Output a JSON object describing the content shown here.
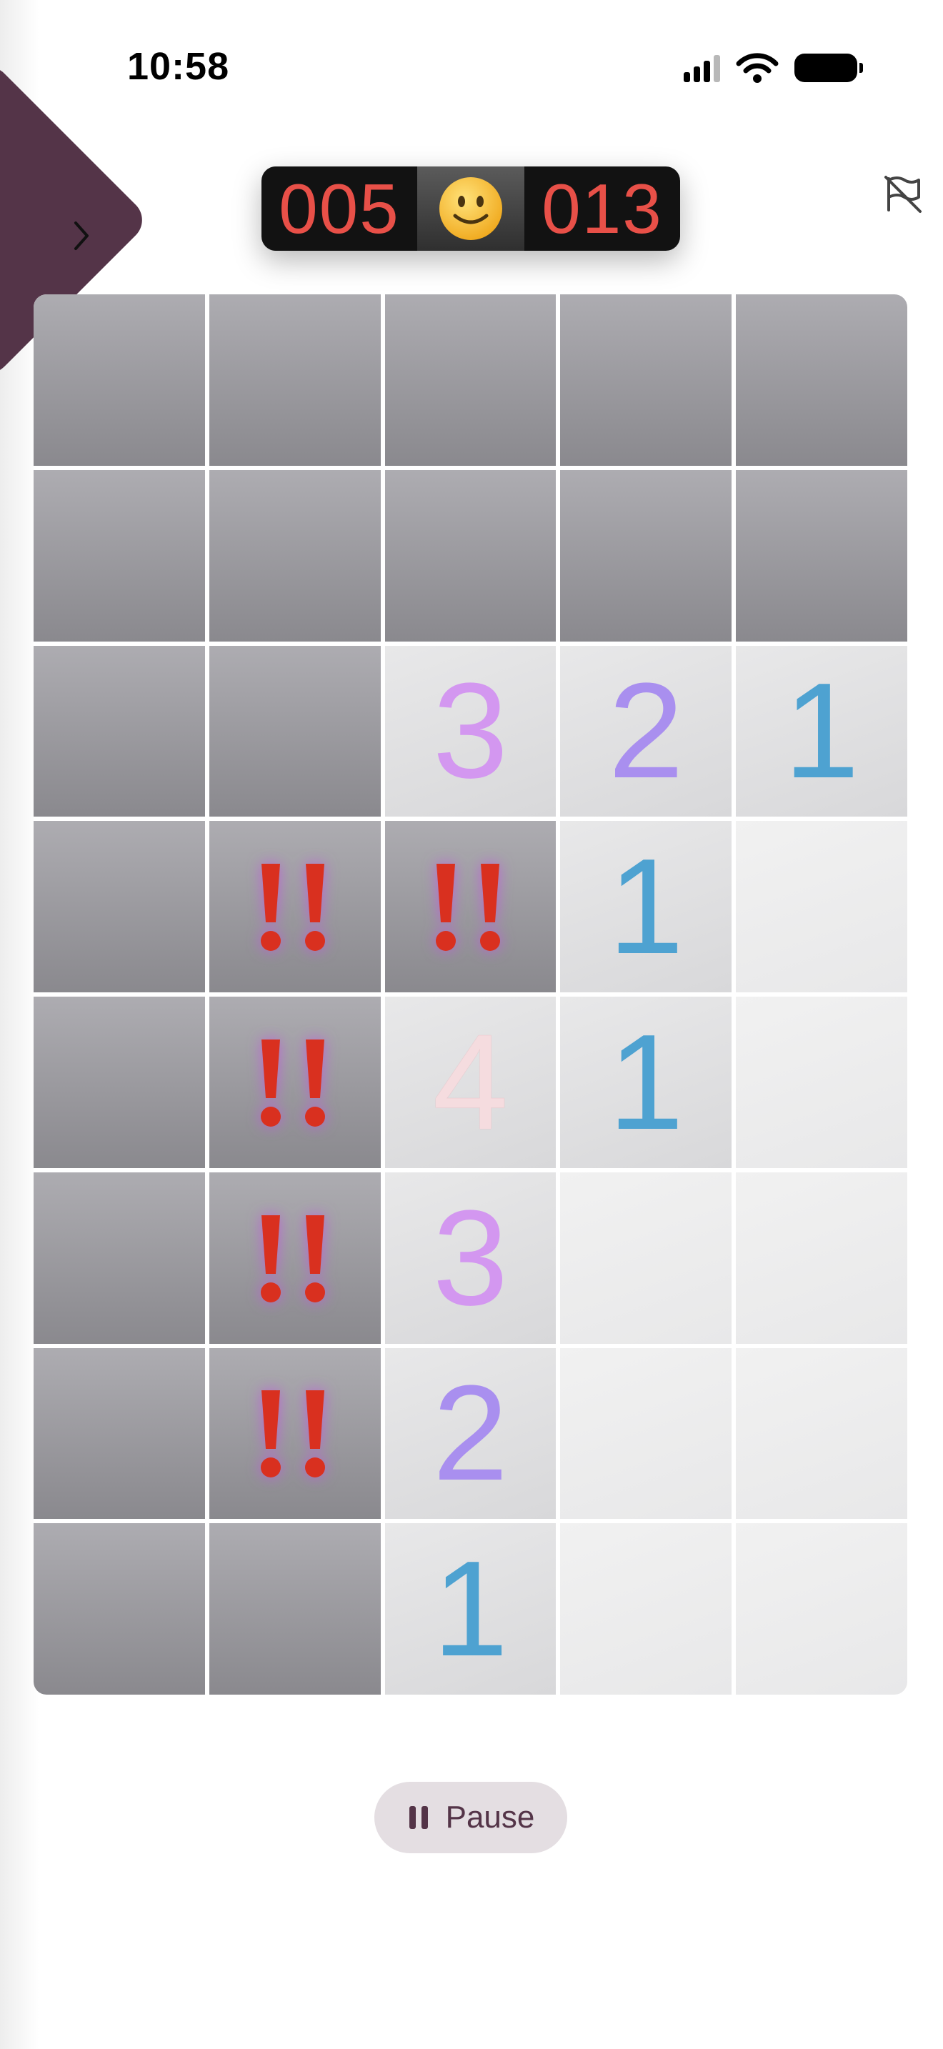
{
  "status_bar": {
    "time": "10:58"
  },
  "game": {
    "mines_left": "005",
    "face_icon": "smiley-face-icon",
    "timer": "013"
  },
  "board": {
    "cols": 5,
    "rows": [
      [
        {
          "state": "covered"
        },
        {
          "state": "covered"
        },
        {
          "state": "covered"
        },
        {
          "state": "covered"
        },
        {
          "state": "covered"
        }
      ],
      [
        {
          "state": "covered"
        },
        {
          "state": "covered"
        },
        {
          "state": "covered"
        },
        {
          "state": "covered"
        },
        {
          "state": "covered"
        }
      ],
      [
        {
          "state": "covered"
        },
        {
          "state": "covered"
        },
        {
          "state": "revealed",
          "value": "3"
        },
        {
          "state": "revealed",
          "value": "2"
        },
        {
          "state": "revealed",
          "value": "1"
        }
      ],
      [
        {
          "state": "covered"
        },
        {
          "state": "flagged"
        },
        {
          "state": "flagged"
        },
        {
          "state": "revealed",
          "value": "1"
        },
        {
          "state": "empty"
        }
      ],
      [
        {
          "state": "covered"
        },
        {
          "state": "flagged"
        },
        {
          "state": "revealed",
          "value": "4"
        },
        {
          "state": "revealed",
          "value": "1"
        },
        {
          "state": "empty"
        }
      ],
      [
        {
          "state": "covered"
        },
        {
          "state": "flagged"
        },
        {
          "state": "revealed",
          "value": "3"
        },
        {
          "state": "empty"
        },
        {
          "state": "empty"
        }
      ],
      [
        {
          "state": "covered"
        },
        {
          "state": "flagged"
        },
        {
          "state": "revealed",
          "value": "2"
        },
        {
          "state": "empty"
        },
        {
          "state": "empty"
        }
      ],
      [
        {
          "state": "covered"
        },
        {
          "state": "covered"
        },
        {
          "state": "revealed",
          "value": "1"
        },
        {
          "state": "empty"
        },
        {
          "state": "empty"
        }
      ]
    ]
  },
  "controls": {
    "pause_label": "Pause"
  },
  "colors": {
    "accent": "#543448",
    "led": "#e85048",
    "flag": "#d9301f",
    "number_1": "#4ea2d1",
    "number_2": "#a98fef",
    "number_3": "#d397f0",
    "number_4": "#f5dcdf"
  }
}
